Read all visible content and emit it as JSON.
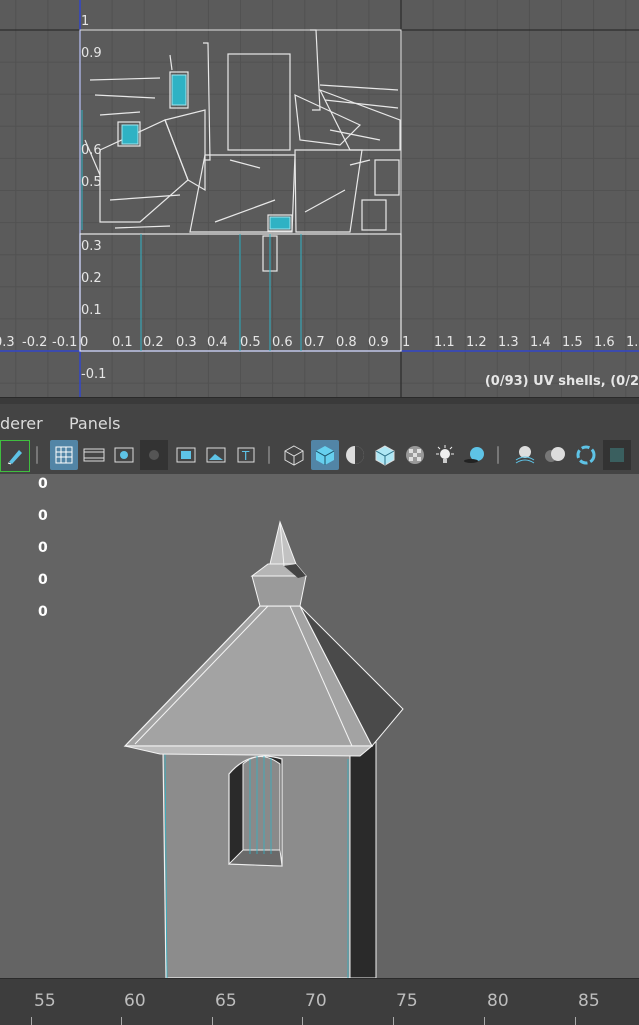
{
  "uv_editor": {
    "u_axis_labels": [
      "0.3",
      "-0.2",
      "-0.1",
      "0",
      "0.1",
      "0.2",
      "0.3",
      "0.4",
      "0.5",
      "0.6",
      "0.7",
      "0.8",
      "0.9",
      "1",
      "1.1",
      "1.2",
      "1.3",
      "1.4",
      "1.5",
      "1.6",
      "1."
    ],
    "v_axis_labels": [
      "1",
      "0.9",
      "0.6",
      "0.5",
      "0.3",
      "0.2",
      "0.1",
      "-0.1"
    ],
    "status": "(0/93) UV shells, (0/2"
  },
  "menubar": {
    "renderer": "derer",
    "panels": "Panels"
  },
  "toolbar": {
    "icons": [
      "paint-brush-icon",
      "grid-icon",
      "film-gate-icon",
      "resolution-gate-icon",
      "field-chart-icon",
      "safe-action-icon",
      "image-plane-icon",
      "text-icon",
      "wireframe-cube-icon",
      "smooth-shade-cube-icon",
      "shaded-sphere-icon",
      "textured-cube-icon",
      "checker-icon",
      "light-icon",
      "shadow-icon",
      "ambient-occlusion-icon",
      "motion-blur-icon",
      "anti-alias-icon",
      "isolate-icon"
    ]
  },
  "viewport": {
    "hud_values": [
      "0",
      "0",
      "0",
      "0",
      "0"
    ]
  },
  "timeline": {
    "frames": [
      "55",
      "60",
      "65",
      "70",
      "75",
      "80",
      "85"
    ]
  },
  "colors": {
    "accent": "#5285a6",
    "uv_highlight": "#2fb2c4",
    "axis": "#3346c9"
  }
}
